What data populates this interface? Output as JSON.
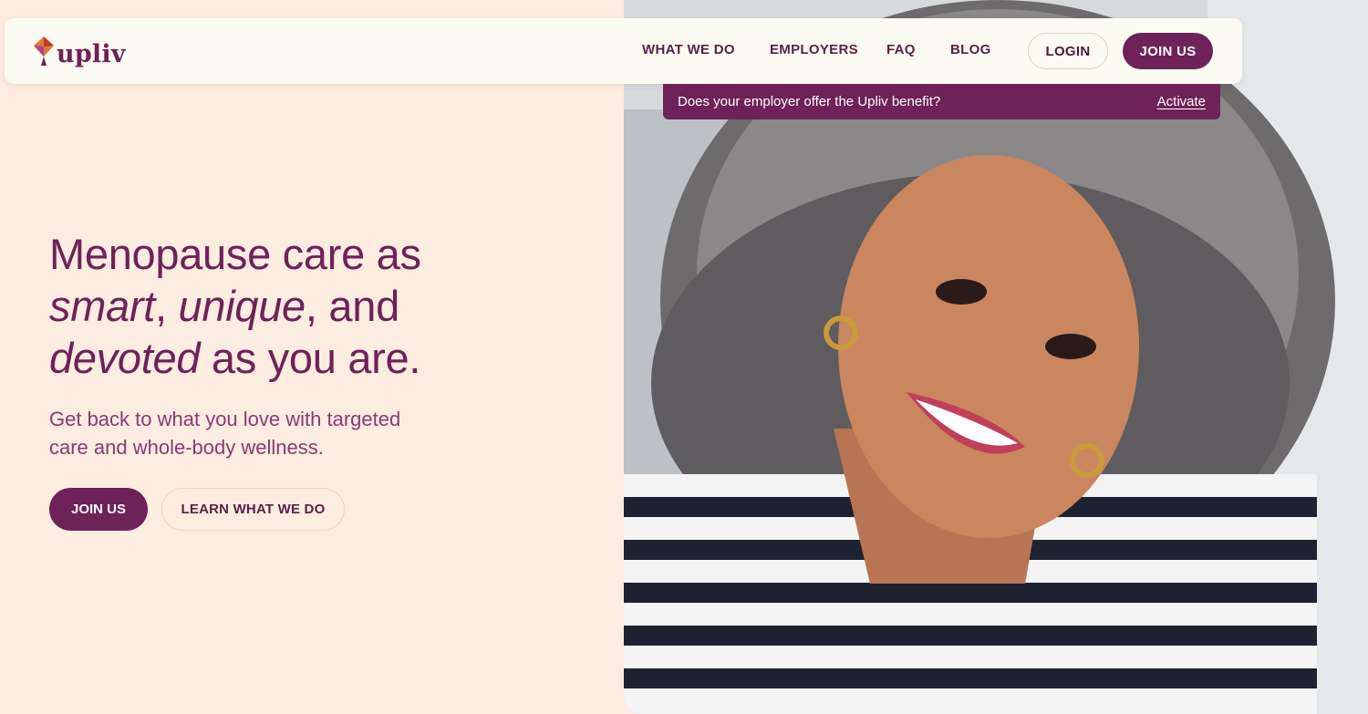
{
  "brand": {
    "name": "upliv",
    "colors": {
      "primary": "#6e2258",
      "background": "#fdece0",
      "navbar": "#fcfbf3"
    }
  },
  "nav": {
    "links": [
      "WHAT WE DO",
      "EMPLOYERS",
      "FAQ",
      "BLOG"
    ],
    "login_label": "LOGIN",
    "join_label": "JOIN US"
  },
  "banner": {
    "text": "Does your employer offer the Upliv benefit?",
    "link": "Activate"
  },
  "hero": {
    "headline": {
      "line1": "Menopause care as",
      "w_smart": "smart",
      "comma1": ",",
      "w_unique": "unique",
      "and": ", and",
      "w_devoted": "devoted",
      "tail": " as you are."
    },
    "subhead": "Get back to what you love with targeted care and whole-body wellness.",
    "join_label": "JOIN US",
    "learn_label": "LEARN WHAT WE DO"
  },
  "icons": {
    "logo": "upliv-logo-icon"
  }
}
